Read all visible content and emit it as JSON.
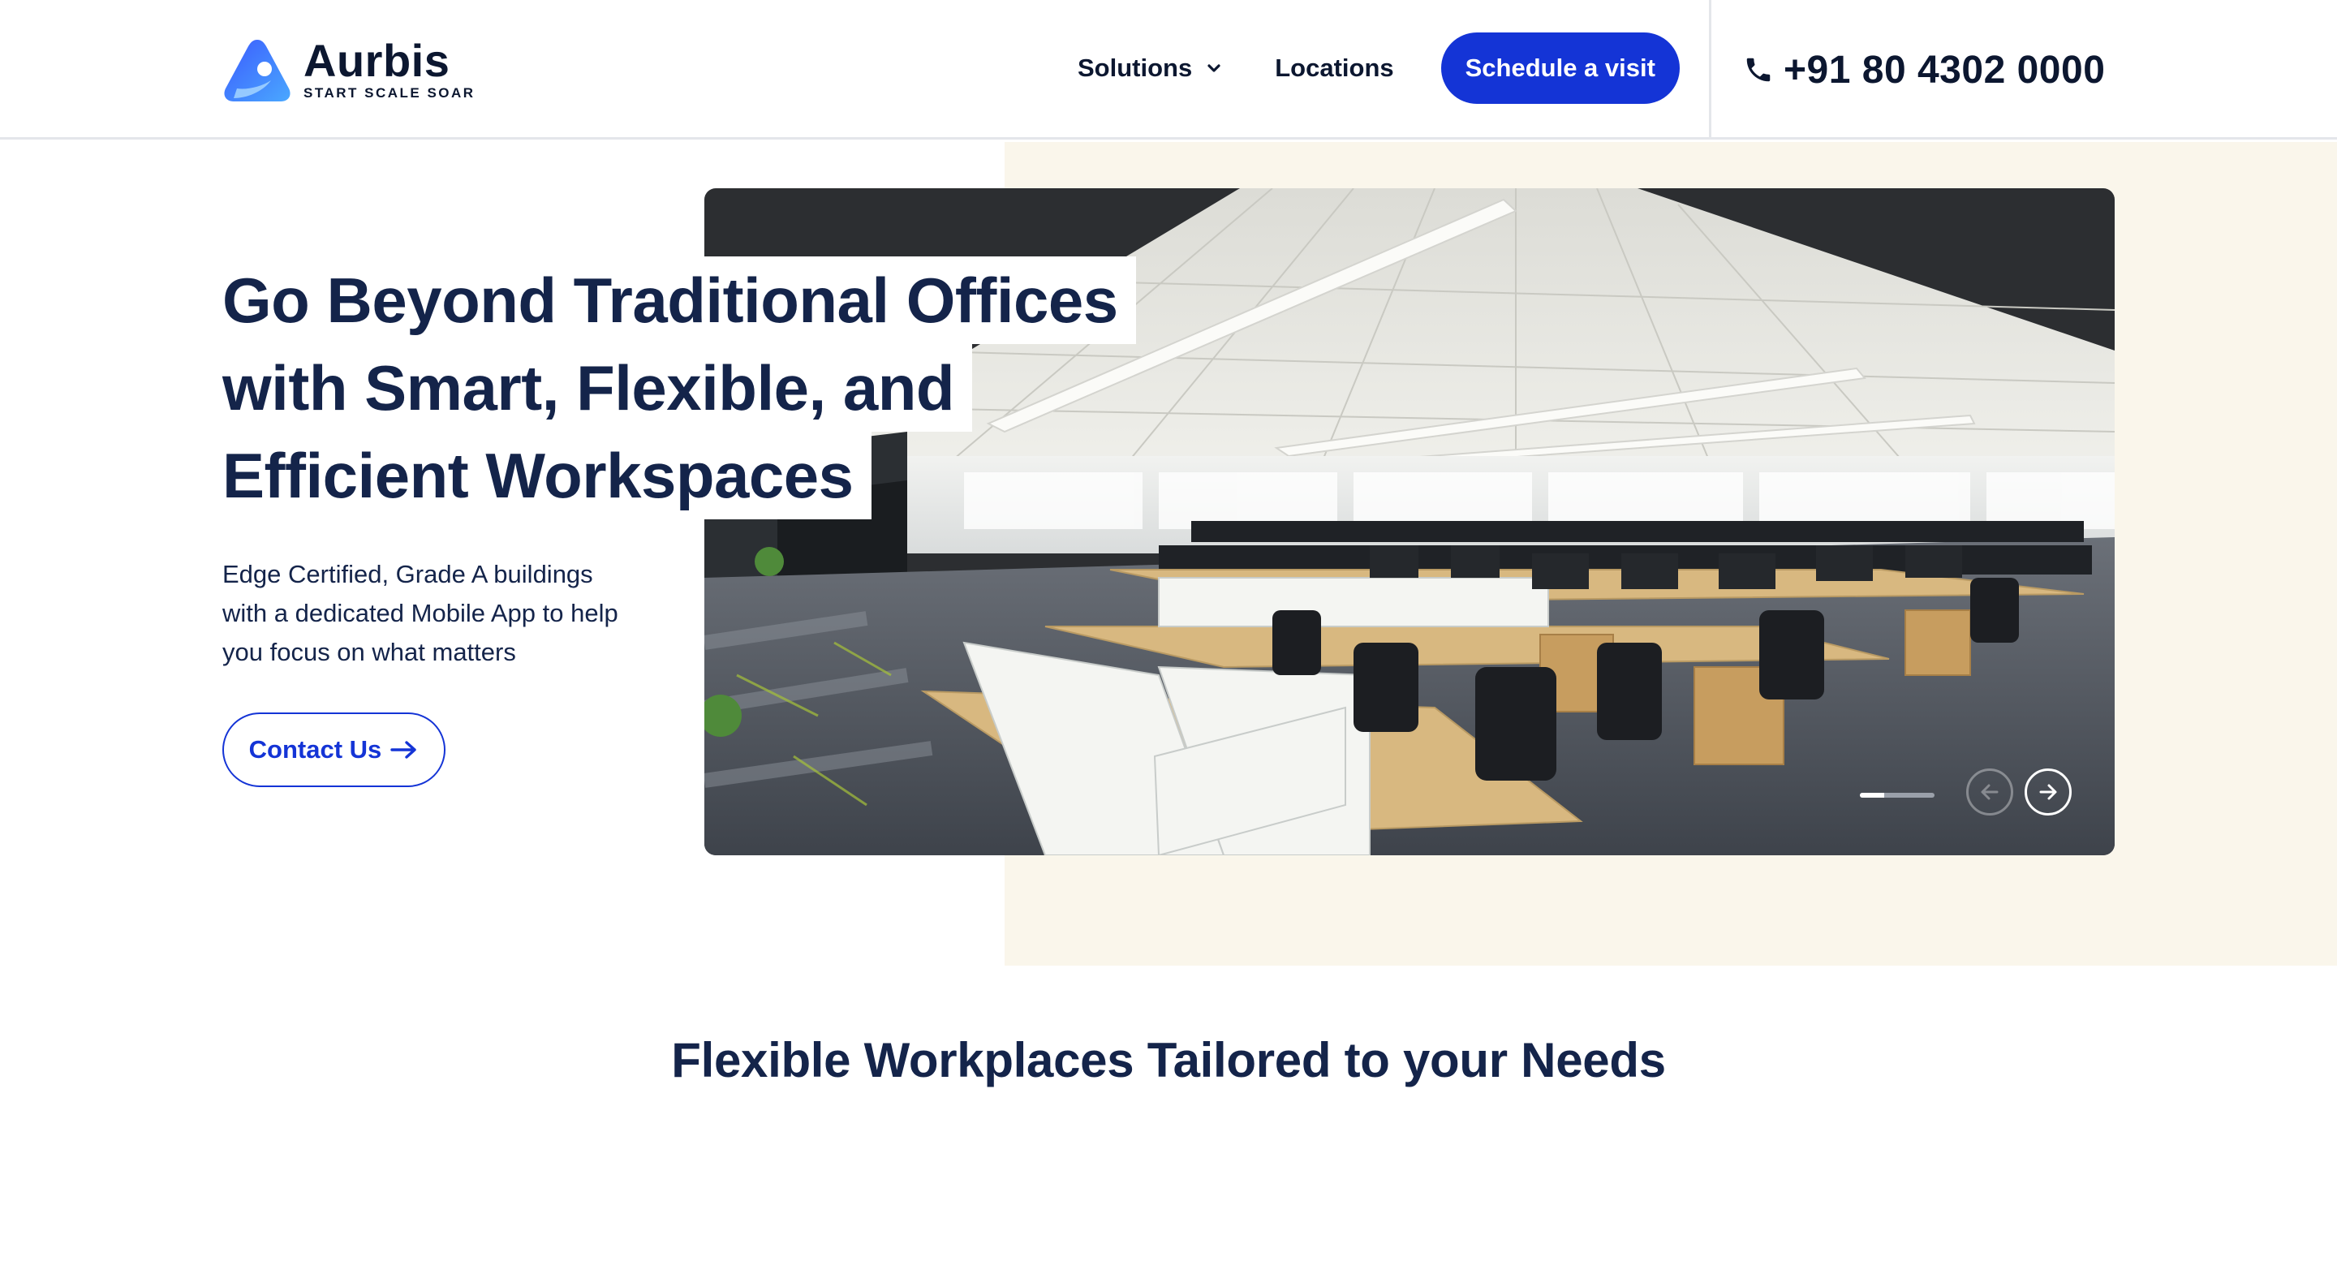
{
  "brand": {
    "name": "Aurbis",
    "tagline": "START SCALE SOAR",
    "logo_icon": "aurbis-logo-mark"
  },
  "nav": {
    "solutions_label": "Solutions",
    "locations_label": "Locations",
    "schedule_label": "Schedule a visit",
    "phone": "+91 80 4302 0000"
  },
  "hero": {
    "headline_lines": [
      "Go Beyond Traditional Offices",
      "with Smart, Flexible, and",
      "Efficient Workspaces"
    ],
    "subtext_lines": [
      "Edge Certified, Grade A buildings",
      "with a dedicated Mobile App to help",
      "you focus on what matters"
    ],
    "cta_label": "Contact Us",
    "carousel": {
      "current_slide_fraction": 0.33
    }
  },
  "section": {
    "title": "Flexible Workplaces Tailored to your Needs"
  },
  "colors": {
    "primary": "#1434d6",
    "navy": "#14244a",
    "cream": "#faf6eb"
  }
}
